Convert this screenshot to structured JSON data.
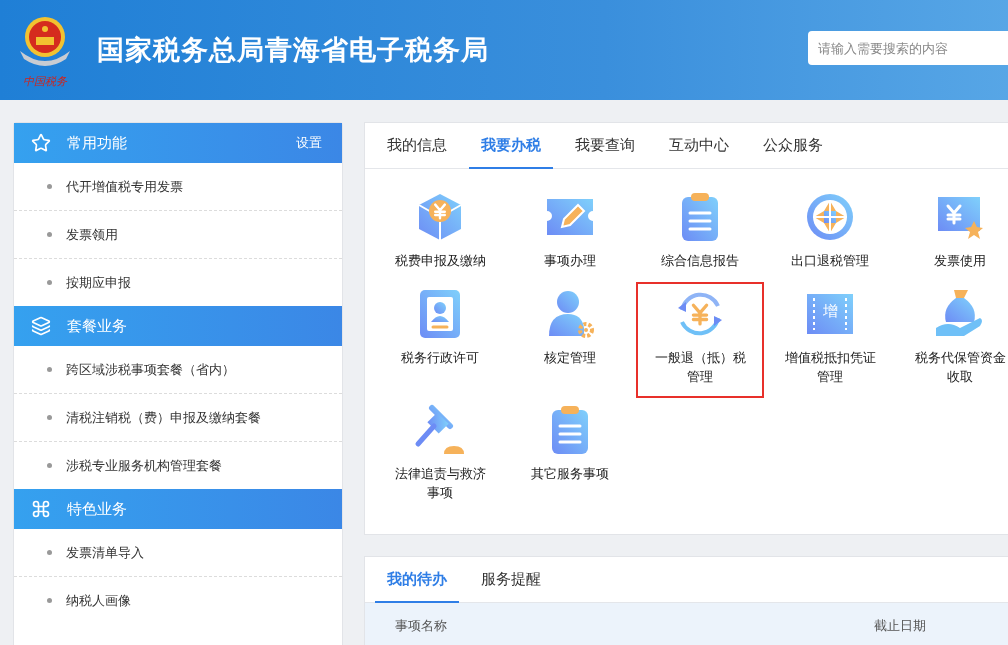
{
  "header": {
    "logo_caption": "中国税务",
    "title": "国家税务总局青海省电子税务局",
    "search": {
      "placeholder": "请输入需要搜索的内容"
    }
  },
  "sidebar": {
    "sections": [
      {
        "title": "常用功能",
        "action": "设置",
        "items": [
          "代开增值税专用发票",
          "发票领用",
          "按期应申报"
        ]
      },
      {
        "title": "套餐业务",
        "items": [
          "跨区域涉税事项套餐（省内）",
          "清税注销税（费）申报及缴纳套餐",
          "涉税专业服务机构管理套餐"
        ]
      },
      {
        "title": "特色业务",
        "items": [
          "发票清单导入",
          "纳税人画像"
        ]
      }
    ]
  },
  "services": {
    "tabs": [
      {
        "label": "我的信息",
        "selected": false
      },
      {
        "label": "我要办税",
        "selected": true
      },
      {
        "label": "我要查询",
        "selected": false
      },
      {
        "label": "互动中心",
        "selected": false
      },
      {
        "label": "公众服务",
        "selected": false
      }
    ],
    "items": [
      {
        "label": "税费申报及缴纳",
        "highlighted": false
      },
      {
        "label": "事项办理",
        "highlighted": false
      },
      {
        "label": "综合信息报告",
        "highlighted": false
      },
      {
        "label": "出口退税管理",
        "highlighted": false
      },
      {
        "label": "发票使用",
        "highlighted": false
      },
      {
        "label": "税务行政许可",
        "highlighted": false
      },
      {
        "label": "核定管理",
        "highlighted": false
      },
      {
        "label": "一般退（抵）税管理",
        "highlighted": true
      },
      {
        "label": "增值税抵扣凭证管理",
        "highlighted": false,
        "icon_text": "增"
      },
      {
        "label": "税务代保管资金收取",
        "highlighted": false
      },
      {
        "label": "法律追责与救济事项",
        "highlighted": false
      },
      {
        "label": "其它服务事项",
        "highlighted": false
      }
    ]
  },
  "todo": {
    "tabs": [
      {
        "label": "我的待办",
        "selected": true
      },
      {
        "label": "服务提醒",
        "selected": false
      }
    ],
    "table": {
      "columns": [
        "事项名称",
        "截止日期"
      ]
    }
  }
}
